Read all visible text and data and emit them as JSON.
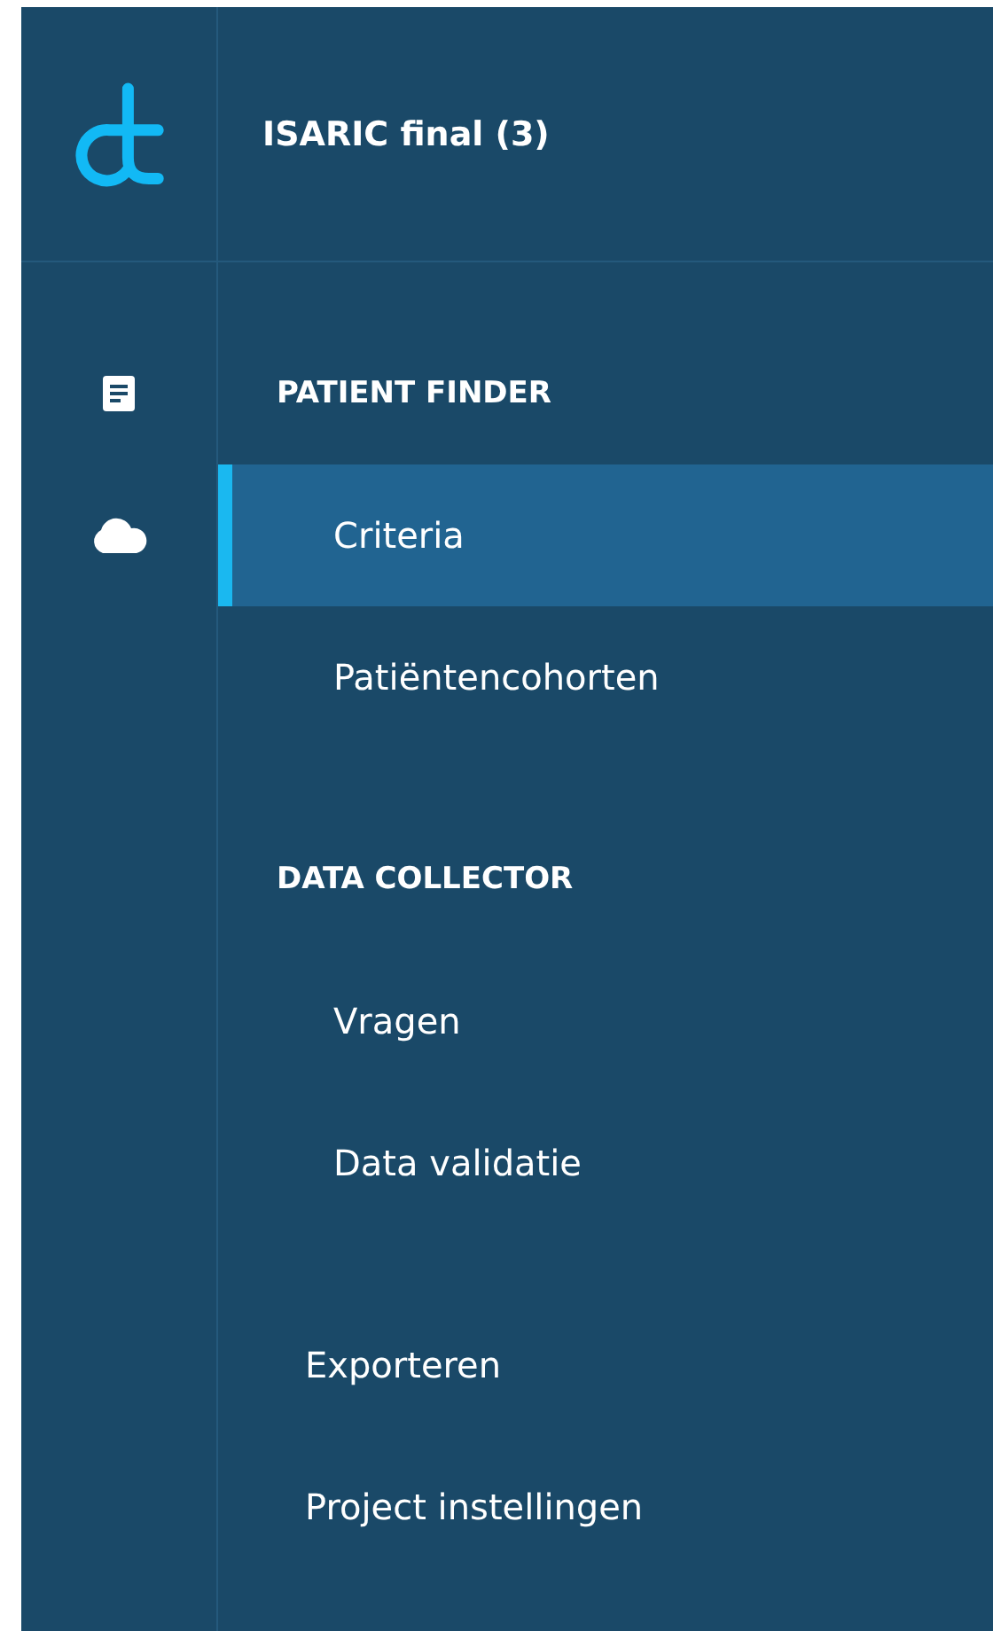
{
  "app": {
    "title": "ISARIC final (3)"
  },
  "rail_icons": [
    {
      "kind": "document"
    },
    {
      "kind": "cloud"
    }
  ],
  "groups": [
    {
      "kind": "section",
      "heading": "PATIENT FINDER",
      "items": [
        {
          "label": "Criteria",
          "selected": true
        },
        {
          "label": "Patiëntencohorten",
          "selected": false
        }
      ]
    },
    {
      "kind": "section",
      "heading": "DATA COLLECTOR",
      "items": [
        {
          "label": "Vragen",
          "selected": false
        },
        {
          "label": "Data validatie",
          "selected": false
        }
      ]
    },
    {
      "kind": "standalone",
      "items": [
        {
          "label": "Exporteren",
          "selected": false
        },
        {
          "label": "Project instellingen",
          "selected": false
        }
      ]
    }
  ]
}
